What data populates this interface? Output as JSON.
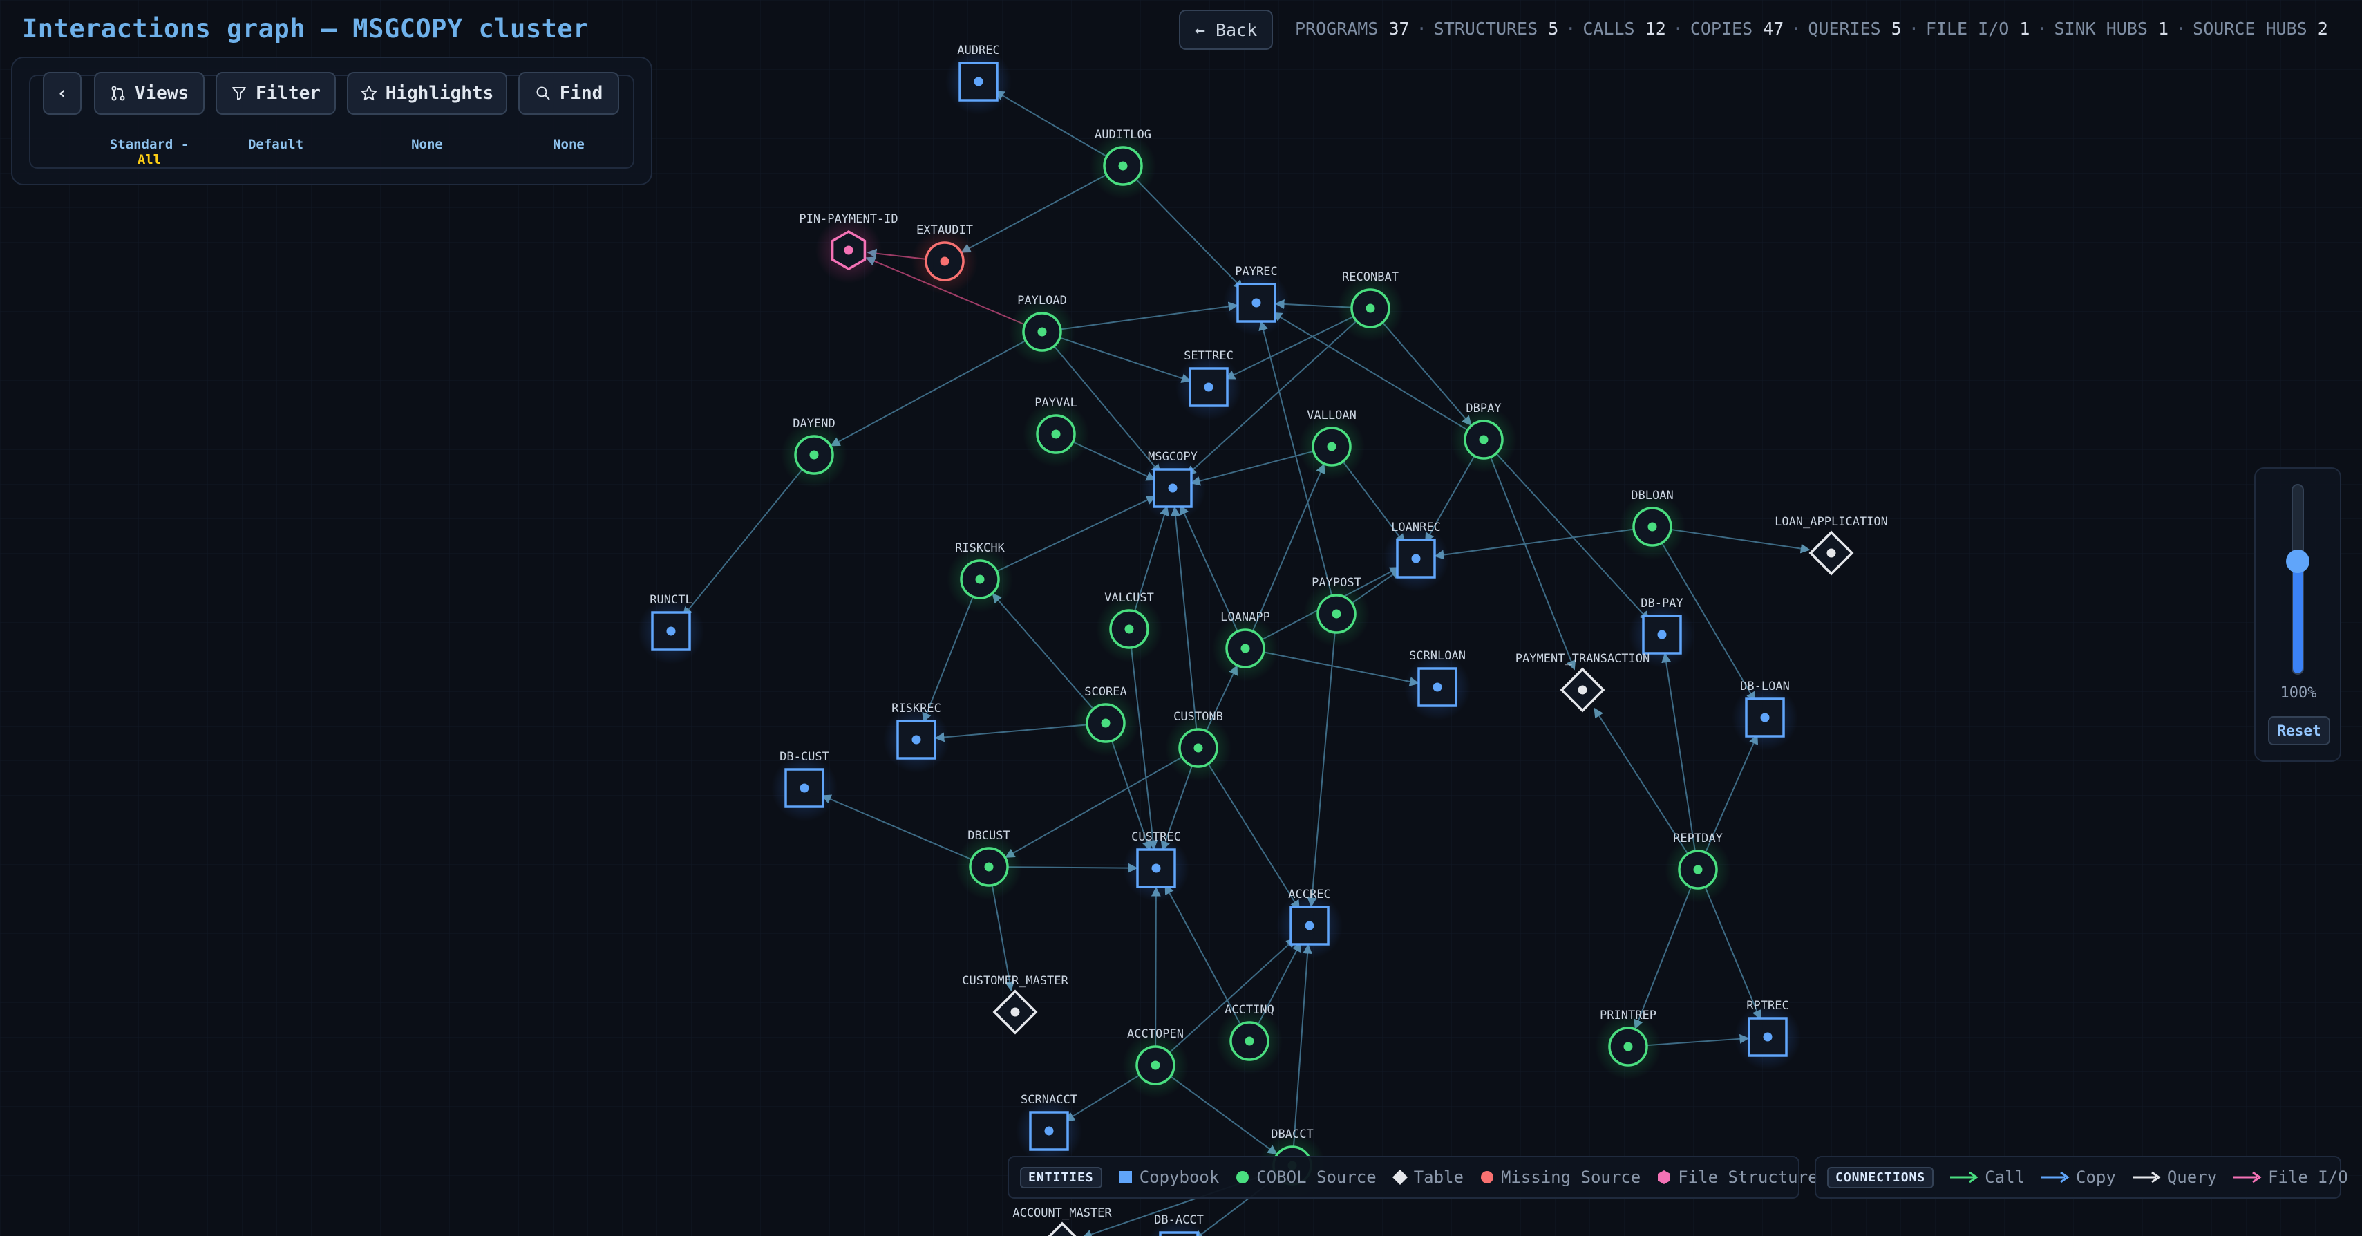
{
  "header": {
    "title": "Interactions graph — MSGCOPY cluster",
    "back_label": "← Back",
    "stats": [
      {
        "label": "PROGRAMS",
        "value": "37"
      },
      {
        "label": "STRUCTURES",
        "value": "5"
      },
      {
        "label": "CALLS",
        "value": "12"
      },
      {
        "label": "COPIES",
        "value": "47"
      },
      {
        "label": "QUERIES",
        "value": "5"
      },
      {
        "label": "FILE I/O",
        "value": "1"
      },
      {
        "label": "SINK HUBS",
        "value": "1"
      },
      {
        "label": "SOURCE HUBS",
        "value": "2"
      }
    ]
  },
  "toolbar": {
    "collapse_icon": "chevron-left-icon",
    "views_label": "Views",
    "views_sub_prefix": "Standard - ",
    "views_sub_accent": "All",
    "filter_label": "Filter",
    "filter_sub": "Default",
    "highlights_label": "Highlights",
    "highlights_sub": "None",
    "find_label": "Find",
    "find_sub": "None"
  },
  "zoom": {
    "level": 0.6,
    "label": "100%",
    "reset_label": "Reset"
  },
  "legend": {
    "entities_title": "ENTITIES",
    "entities": [
      {
        "label": "Copybook",
        "shape": "square",
        "color": "#60a5fa"
      },
      {
        "label": "COBOL Source",
        "shape": "circle",
        "color": "#4ade80"
      },
      {
        "label": "Table",
        "shape": "diamond",
        "color": "#e5e7eb"
      },
      {
        "label": "Missing Source",
        "shape": "circle",
        "color": "#f87171"
      },
      {
        "label": "File Structure",
        "shape": "hexagon",
        "color": "#f472b6"
      }
    ],
    "connections_title": "CONNECTIONS",
    "connections": [
      {
        "label": "Call",
        "color": "#4ade80"
      },
      {
        "label": "Copy",
        "color": "#60a5fa"
      },
      {
        "label": "Query",
        "color": "#e5e7eb"
      },
      {
        "label": "File I/O",
        "color": "#f472b6"
      }
    ]
  },
  "colors": {
    "program": "#4ade80",
    "copybook": "#60a5fa",
    "table": "#e5e7eb",
    "missing": "#f87171",
    "file": "#f472b6",
    "edge": "#3d6a84",
    "background": "#0b0f17"
  },
  "graph": {
    "nodes": [
      {
        "id": "AUDREC",
        "type": "copybook"
      },
      {
        "id": "AUDITLOG",
        "type": "program"
      },
      {
        "id": "PIN-PAYMENT-ID",
        "type": "file"
      },
      {
        "id": "EXTAUDIT",
        "type": "missing"
      },
      {
        "id": "PAYLOAD",
        "type": "program"
      },
      {
        "id": "PAYREC",
        "type": "copybook"
      },
      {
        "id": "RECONBAT",
        "type": "program"
      },
      {
        "id": "SETTREC",
        "type": "copybook"
      },
      {
        "id": "DAYEND",
        "type": "program"
      },
      {
        "id": "PAYVAL",
        "type": "program"
      },
      {
        "id": "VALLOAN",
        "type": "program"
      },
      {
        "id": "DBPAY",
        "type": "program"
      },
      {
        "id": "MSGCOPY",
        "type": "copybook"
      },
      {
        "id": "DBLOAN",
        "type": "program"
      },
      {
        "id": "LOAN_APPLICATION",
        "type": "table"
      },
      {
        "id": "LOANREC",
        "type": "copybook"
      },
      {
        "id": "RISKCHK",
        "type": "program"
      },
      {
        "id": "RUNCTL",
        "type": "copybook"
      },
      {
        "id": "VALCUST",
        "type": "program"
      },
      {
        "id": "PAYPOST",
        "type": "program"
      },
      {
        "id": "LOANAPP",
        "type": "program"
      },
      {
        "id": "DB-PAY",
        "type": "copybook"
      },
      {
        "id": "SCRNLOAN",
        "type": "copybook"
      },
      {
        "id": "PAYMENT_TRANSACTION",
        "type": "table"
      },
      {
        "id": "DB-LOAN",
        "type": "copybook"
      },
      {
        "id": "RISKREC",
        "type": "copybook"
      },
      {
        "id": "SCOREA",
        "type": "program"
      },
      {
        "id": "CUSTONB",
        "type": "program"
      },
      {
        "id": "DB-CUST",
        "type": "copybook"
      },
      {
        "id": "DBCUST",
        "type": "program"
      },
      {
        "id": "CUSTREC",
        "type": "copybook"
      },
      {
        "id": "REPTDAY",
        "type": "program"
      },
      {
        "id": "ACCREC",
        "type": "copybook"
      },
      {
        "id": "CUSTOMER_MASTER",
        "type": "table"
      },
      {
        "id": "ACCTINQ",
        "type": "program"
      },
      {
        "id": "PRINTREP",
        "type": "program"
      },
      {
        "id": "RPTREC",
        "type": "copybook"
      },
      {
        "id": "ACCTOPEN",
        "type": "program"
      },
      {
        "id": "SCRNACCT",
        "type": "copybook"
      },
      {
        "id": "DBACCT",
        "type": "program"
      },
      {
        "id": "ACCOUNT_MASTER",
        "type": "table"
      },
      {
        "id": "DB-ACCT",
        "type": "copybook"
      }
    ],
    "edges": [
      [
        "AUDITLOG",
        "AUDREC"
      ],
      [
        "AUDITLOG",
        "EXTAUDIT"
      ],
      [
        "AUDITLOG",
        "PAYREC"
      ],
      [
        "EXTAUDIT",
        "PIN-PAYMENT-ID"
      ],
      [
        "PAYLOAD",
        "PIN-PAYMENT-ID"
      ],
      [
        "PAYLOAD",
        "PAYREC"
      ],
      [
        "PAYLOAD",
        "SETTREC"
      ],
      [
        "PAYLOAD",
        "MSGCOPY"
      ],
      [
        "PAYLOAD",
        "DAYEND"
      ],
      [
        "RECONBAT",
        "PAYREC"
      ],
      [
        "RECONBAT",
        "MSGCOPY"
      ],
      [
        "RECONBAT",
        "SETTREC"
      ],
      [
        "RECONBAT",
        "DBPAY"
      ],
      [
        "DAYEND",
        "RUNCTL"
      ],
      [
        "PAYVAL",
        "MSGCOPY"
      ],
      [
        "VALLOAN",
        "MSGCOPY"
      ],
      [
        "VALLOAN",
        "LOANREC"
      ],
      [
        "DBPAY",
        "PAYREC"
      ],
      [
        "DBPAY",
        "LOANREC"
      ],
      [
        "DBPAY",
        "DB-PAY"
      ],
      [
        "DBPAY",
        "PAYMENT_TRANSACTION"
      ],
      [
        "DBLOAN",
        "LOAN_APPLICATION"
      ],
      [
        "DBLOAN",
        "LOANREC"
      ],
      [
        "DBLOAN",
        "DB-LOAN"
      ],
      [
        "RISKCHK",
        "MSGCOPY"
      ],
      [
        "RISKCHK",
        "RISKREC"
      ],
      [
        "VALCUST",
        "MSGCOPY"
      ],
      [
        "VALCUST",
        "CUSTREC"
      ],
      [
        "PAYPOST",
        "PAYREC"
      ],
      [
        "PAYPOST",
        "LOANREC"
      ],
      [
        "PAYPOST",
        "ACCREC"
      ],
      [
        "LOANAPP",
        "MSGCOPY"
      ],
      [
        "LOANAPP",
        "VALLOAN"
      ],
      [
        "LOANAPP",
        "SCRNLOAN"
      ],
      [
        "LOANAPP",
        "LOANREC"
      ],
      [
        "SCOREA",
        "RISKCHK"
      ],
      [
        "SCOREA",
        "RISKREC"
      ],
      [
        "SCOREA",
        "CUSTREC"
      ],
      [
        "CUSTONB",
        "MSGCOPY"
      ],
      [
        "CUSTONB",
        "LOANAPP"
      ],
      [
        "CUSTONB",
        "CUSTREC"
      ],
      [
        "CUSTONB",
        "DBCUST"
      ],
      [
        "CUSTONB",
        "ACCREC"
      ],
      [
        "DBCUST",
        "DB-CUST"
      ],
      [
        "DBCUST",
        "CUSTREC"
      ],
      [
        "DBCUST",
        "CUSTOMER_MASTER"
      ],
      [
        "REPTDAY",
        "PAYMENT_TRANSACTION"
      ],
      [
        "REPTDAY",
        "DB-PAY"
      ],
      [
        "REPTDAY",
        "DB-LOAN"
      ],
      [
        "REPTDAY",
        "PRINTREP"
      ],
      [
        "REPTDAY",
        "RPTREC"
      ],
      [
        "PRINTREP",
        "RPTREC"
      ],
      [
        "ACCTINQ",
        "ACCREC"
      ],
      [
        "ACCTINQ",
        "CUSTREC"
      ],
      [
        "ACCTOPEN",
        "CUSTREC"
      ],
      [
        "ACCTOPEN",
        "ACCREC"
      ],
      [
        "ACCTOPEN",
        "SCRNACCT"
      ],
      [
        "ACCTOPEN",
        "DBACCT"
      ],
      [
        "DBACCT",
        "ACCREC"
      ],
      [
        "DBACCT",
        "ACCOUNT_MASTER"
      ],
      [
        "DBACCT",
        "DB-ACCT"
      ]
    ]
  }
}
